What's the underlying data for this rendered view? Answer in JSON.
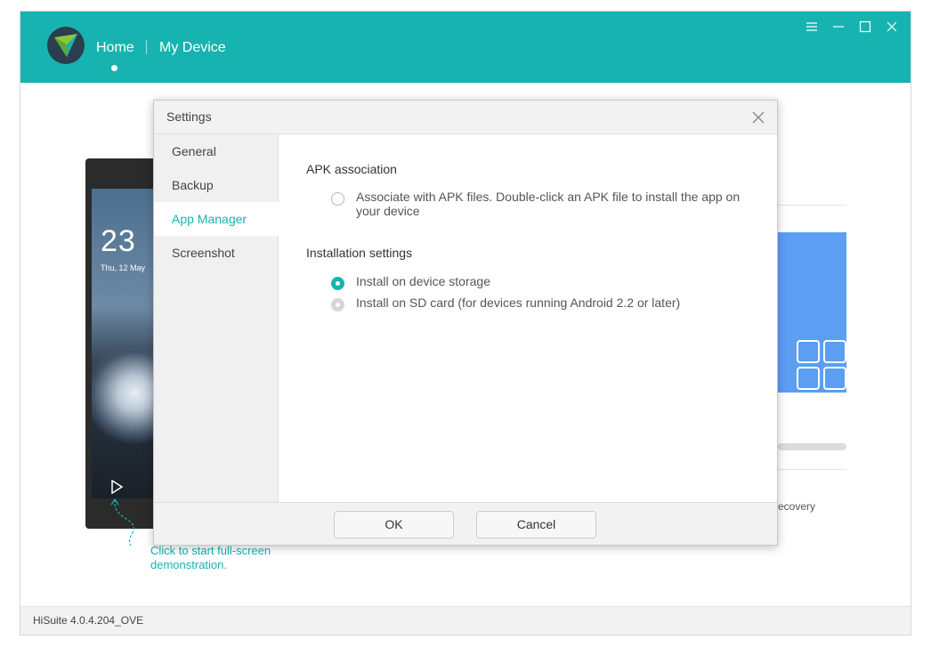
{
  "app": {
    "nav_home": "Home",
    "nav_device": "My Device",
    "version": "HiSuite 4.0.4.204_OVE",
    "accent_color": "#17b3b0"
  },
  "background": {
    "phone_clock": "23",
    "phone_date": "Thu, 12 May",
    "hint_line1": "Click to start full-screen",
    "hint_line2": "demonstration.",
    "recovery_text": "ecovery"
  },
  "dialog": {
    "title": "Settings",
    "sidebar": [
      {
        "label": "General"
      },
      {
        "label": "Backup"
      },
      {
        "label": "App Manager"
      },
      {
        "label": "Screenshot"
      }
    ],
    "active_tab": "App Manager",
    "apk_section": {
      "title": "APK association",
      "option_label": "Associate with APK files. Double-click an APK file to install the app on your device",
      "checked": false
    },
    "install_section": {
      "title": "Installation settings",
      "options": [
        {
          "label": "Install on device storage",
          "checked": true
        },
        {
          "label": "Install on SD card (for devices running Android 2.2 or later)",
          "checked": false
        }
      ]
    },
    "ok_label": "OK",
    "cancel_label": "Cancel"
  }
}
